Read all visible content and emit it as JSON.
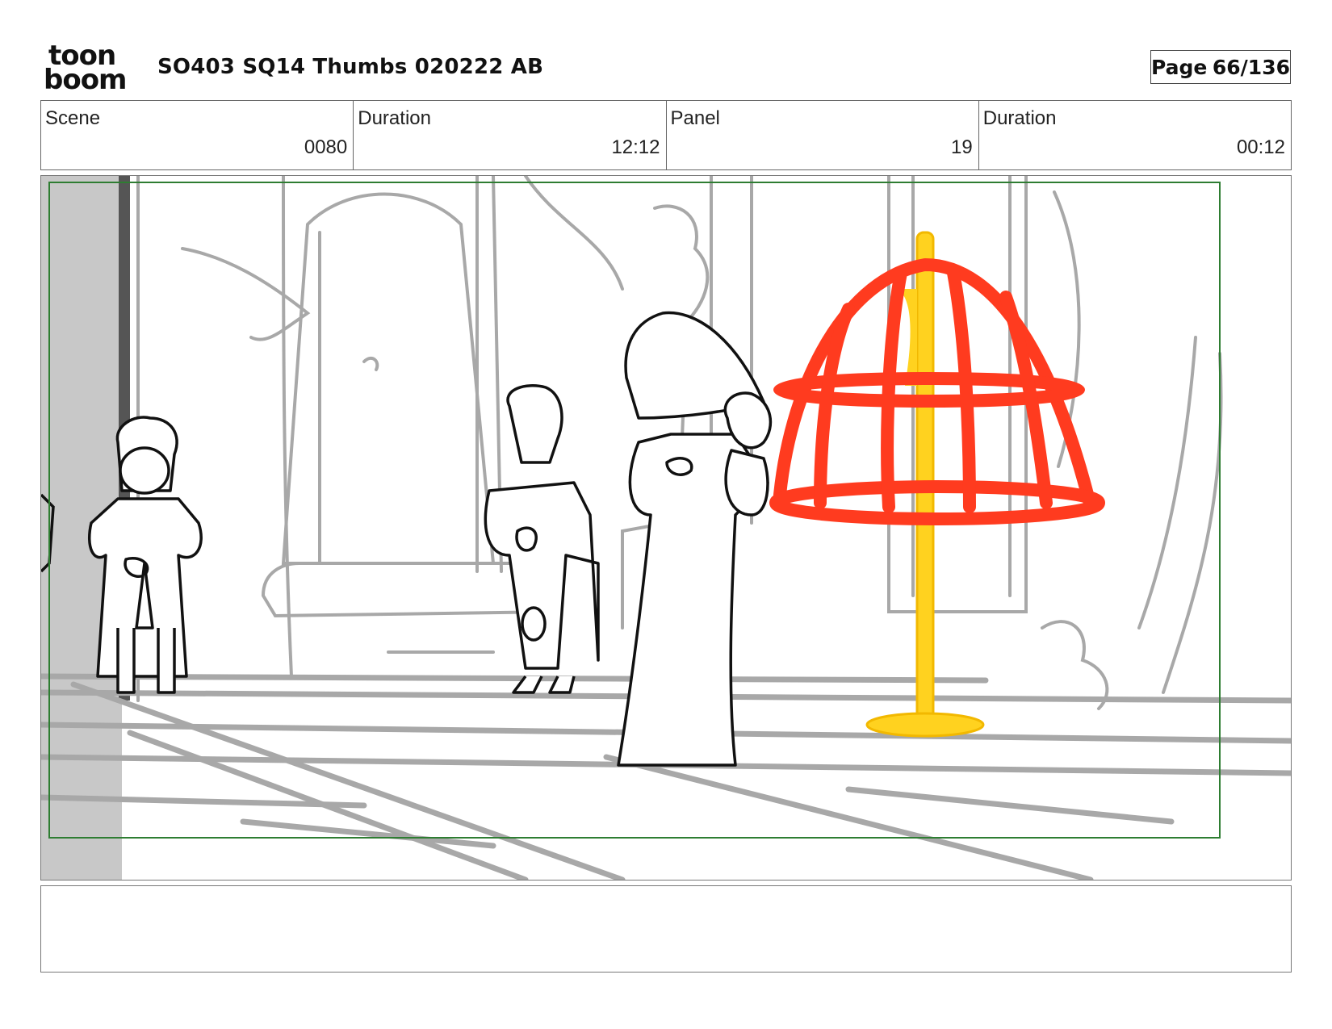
{
  "logo": {
    "line1": "toon",
    "line2": "boom"
  },
  "document_title": "SO403 SQ14 Thumbs 020222 AB",
  "page": {
    "label": "Page",
    "value": "66/136"
  },
  "info": {
    "scene_label": "Scene",
    "scene_value": "0080",
    "scene_duration_label": "Duration",
    "scene_duration_value": "12:12",
    "panel_label": "Panel",
    "panel_value": "19",
    "panel_duration_label": "Duration",
    "panel_duration_value": "00:12"
  },
  "panel_drawing": {
    "description_visible_text": "",
    "colors": {
      "safe_frame": "#2e7d32",
      "cage": "#ff3b1f",
      "pole": "#ffd21f",
      "background_lines": "#a8a8a8",
      "ink": "#111111"
    }
  },
  "notes": {
    "text": ""
  }
}
